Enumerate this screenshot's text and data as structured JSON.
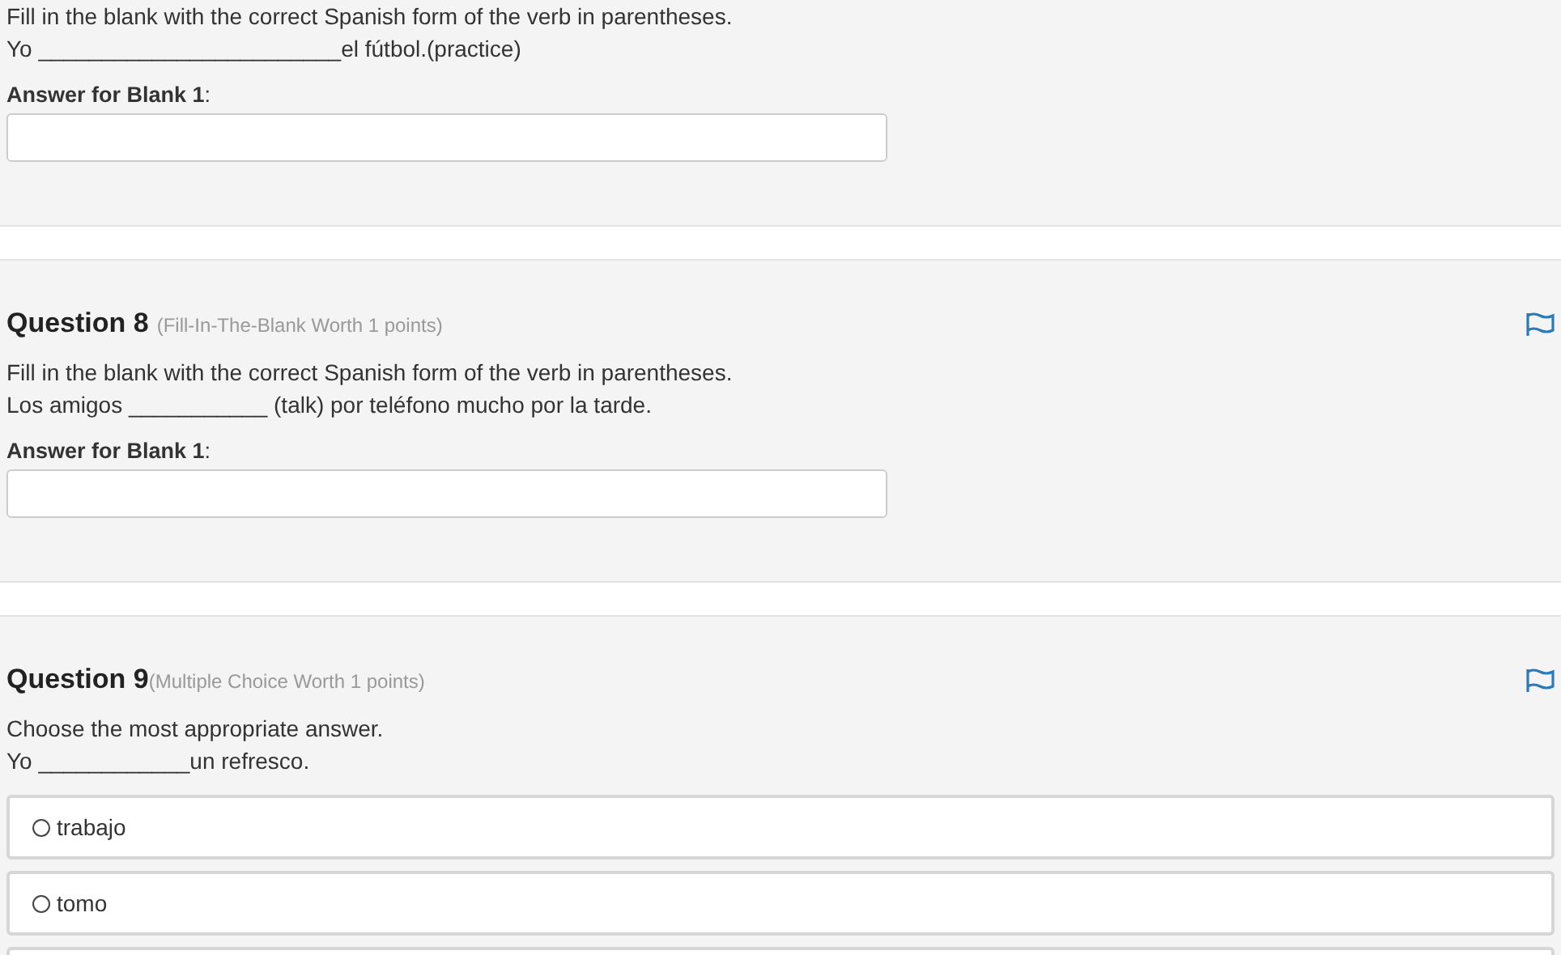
{
  "questions": [
    {
      "kind": "fill_blank",
      "prompt": [
        "Fill in the blank with the correct Spanish form of the verb in parentheses.",
        "Yo ________________________el fútbol.(practice)"
      ],
      "answers": [
        {
          "label": "**Answer for Blank 1**:"
        }
      ]
    },
    {
      "kind": "fill_blank",
      "title": "Question 8",
      "meta": "(Fill-In-The-Blank Worth 1 points)",
      "prompt": [
        "Fill in the blank with the correct Spanish form of the verb in parentheses.",
        "Los amigos ___________ (talk) por teléfono mucho por la tarde."
      ],
      "answers": [
        {
          "label": "**Answer for Blank 1**:"
        }
      ]
    },
    {
      "kind": "multiple_choice",
      "title": "Question 9",
      "meta": "(Multiple Choice Worth 1 points)",
      "prompt": [
        "Choose the most appropriate answer.",
        "Yo ____________un refresco."
      ],
      "options": [
        {
          "label": "trabajo",
          "selected": false
        },
        {
          "label": "tomo",
          "selected": false
        },
        {
          "partial": true
        }
      ]
    }
  ]
}
